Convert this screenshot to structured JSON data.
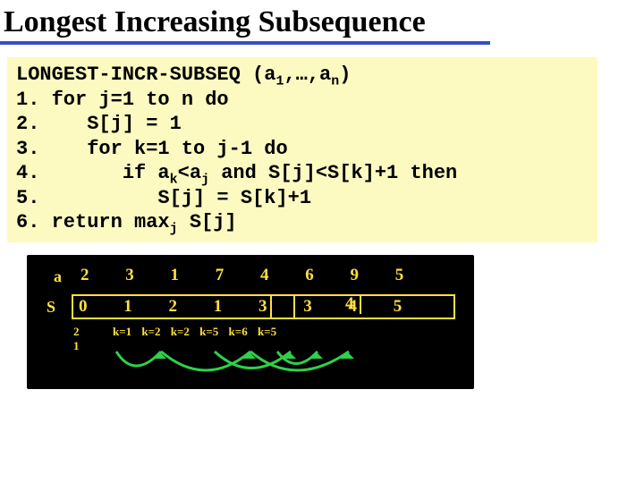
{
  "title": "Longest Increasing Subsequence",
  "code": {
    "head_pre": "LONGEST-INCR-SUBSEQ (a",
    "head_sub1": "1",
    "head_mid": ",…,a",
    "head_sub2": "n",
    "head_post": ")",
    "l1": "1. for j=1 to n do",
    "l2": "2.    S[j] = 1",
    "l3": "3.    for k=1 to j-1 do",
    "l4_pre": "4.       if a",
    "l4_k": "k",
    "l4_mid1": "<a",
    "l4_j": "j",
    "l4_mid2": " and S[j]<S[k]+1 then",
    "l5": "5.          S[j] = S[k]+1",
    "l6_pre": "6. return max",
    "l6_sub": "j",
    "l6_post": " S[j]"
  },
  "board": {
    "a_label": "a",
    "a_values": "2 3 1 7 4 6 9 5",
    "s_label": "S",
    "s_values": "0 1 2 1 3 3 4 5",
    "s_tail": "4",
    "k_first": "2\n1",
    "k_labels": "k=1    k=2 k=2 k=5 k=6 k=5"
  }
}
